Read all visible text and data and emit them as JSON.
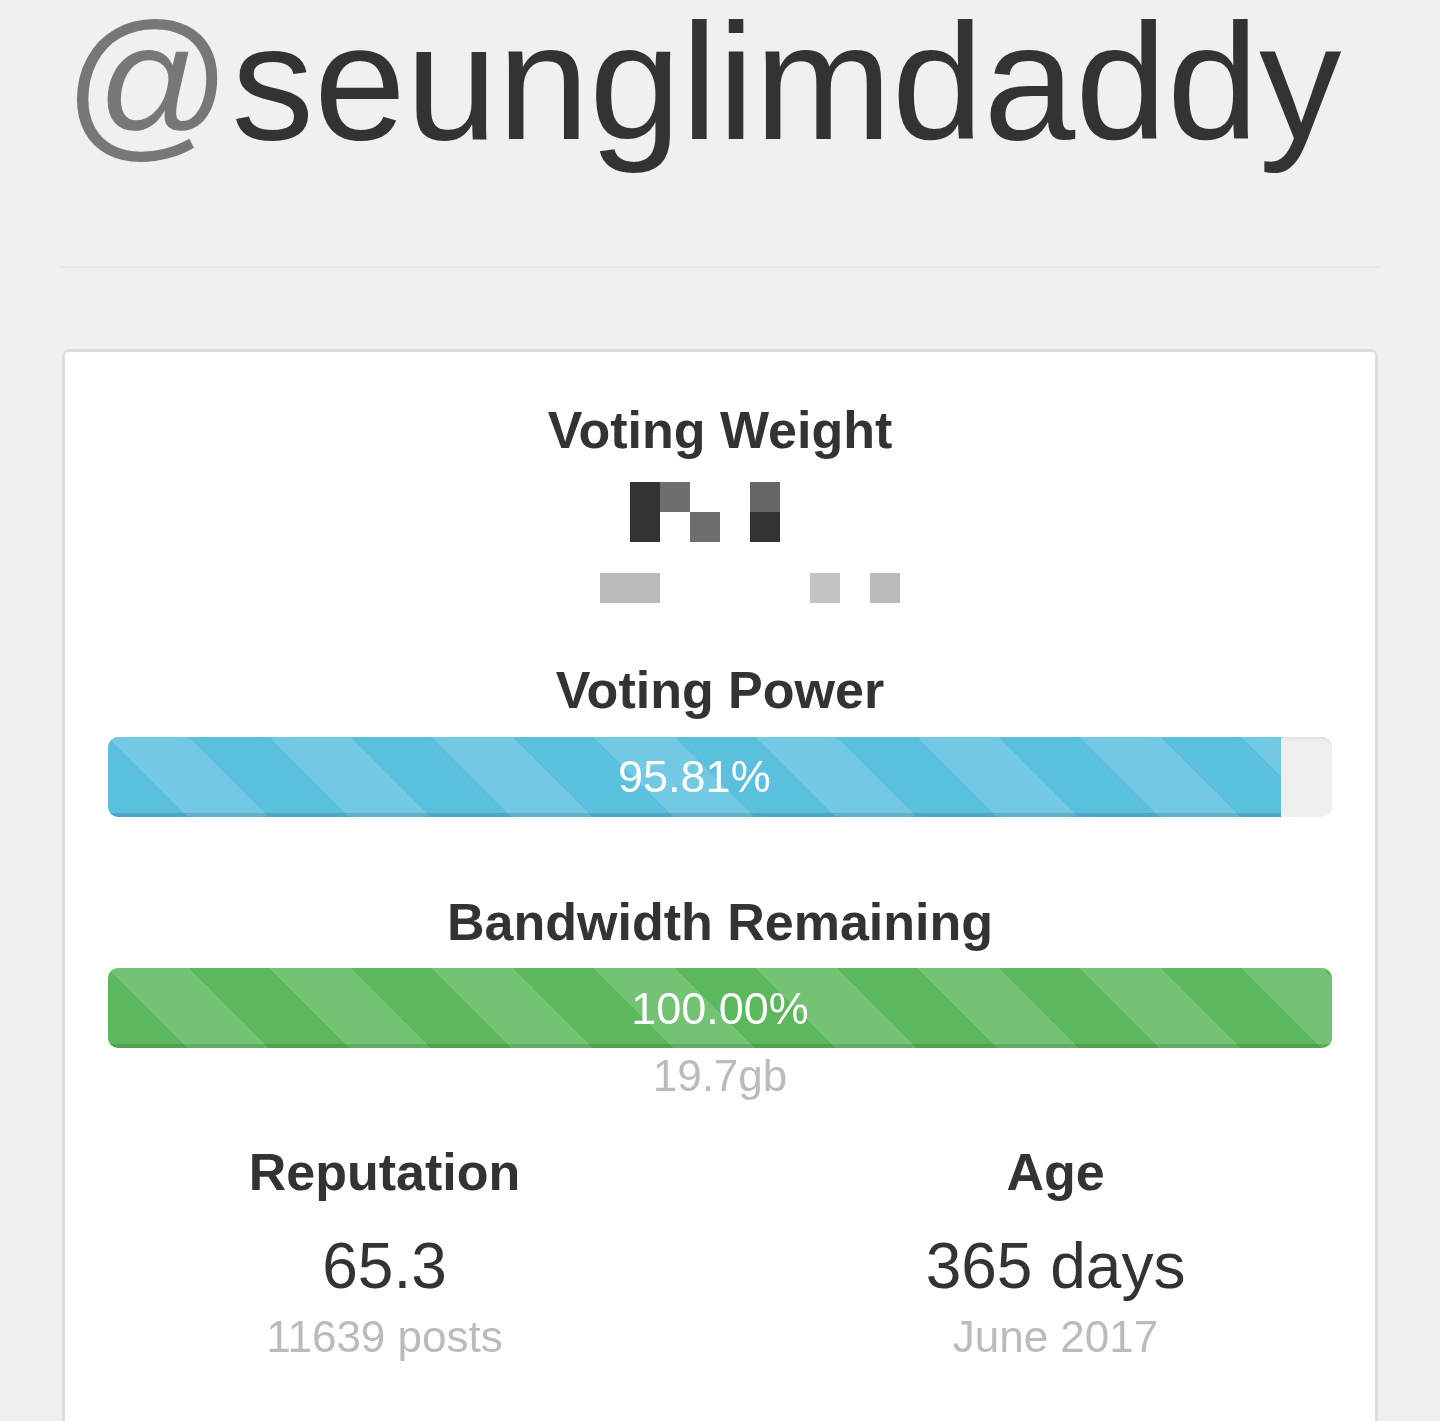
{
  "profile": {
    "at_sign": "@",
    "username": "seunglimdaddy"
  },
  "sections": [
    {
      "kind": "obscured",
      "title": "Voting Weight"
    },
    {
      "kind": "meter",
      "title": "Voting Power",
      "level": 0.9581,
      "reading": "95.81%",
      "color": "#5bc0de"
    },
    {
      "kind": "meter",
      "title": "Bandwidth Remaining",
      "level": 1.0,
      "reading": "100.00%",
      "note": "19.7gb",
      "color": "#5cb85c"
    }
  ],
  "stats": [
    {
      "label": "Reputation",
      "value": "65.3",
      "detail": "11639 posts"
    },
    {
      "label": "Age",
      "value": "365 days",
      "detail": "June 2017"
    }
  ]
}
